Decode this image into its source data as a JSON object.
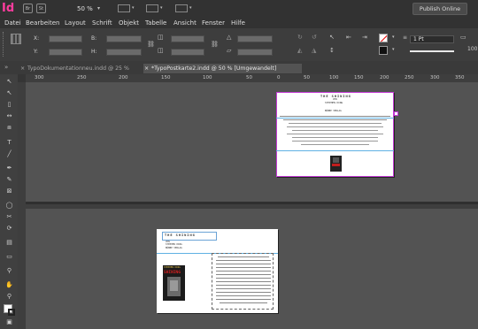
{
  "app": {
    "logo": "Id",
    "br_label": "Br",
    "st_label": "St",
    "zoom": "50 %",
    "publish_label": "Publish Online"
  },
  "menu": [
    "Datei",
    "Bearbeiten",
    "Layout",
    "Schrift",
    "Objekt",
    "Tabelle",
    "Ansicht",
    "Fenster",
    "Hilfe"
  ],
  "control": {
    "x_label": "X:",
    "y_label": "Y:",
    "b_label": "B:",
    "h_label": "H:",
    "stroke_weight": "1 Pt",
    "percent": "100"
  },
  "tabs": [
    {
      "title": "TypoDokumentationneu.indd @ 25 %",
      "close": "×"
    },
    {
      "title": "*TypoPostkarte2.indd @ 50 % [Umgewandelt]",
      "close": "×"
    }
  ],
  "ruler": {
    "marks": [
      "300",
      "250",
      "200",
      "150",
      "100",
      "50",
      "0",
      "50",
      "100",
      "150",
      "200",
      "250",
      "300",
      "350"
    ]
  },
  "page1": {
    "title": "THE SHINING",
    "subtitle": "VON",
    "author": "STEPHEN KING",
    "publisher": "BÜBBE VERLAG"
  },
  "page2": {
    "title": "THE SHINING",
    "line1": "VON",
    "line2": "STEPHEN KING",
    "line3": "BÜBBE VERLAG",
    "cover_title": "SHINING",
    "cover_author": "STEPHEN KING"
  }
}
